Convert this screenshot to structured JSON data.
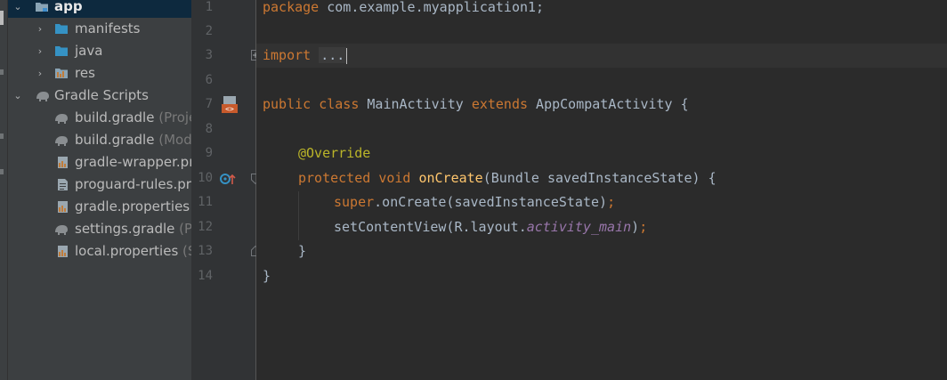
{
  "project_tree": {
    "items": [
      {
        "label": "app",
        "suffix": "",
        "icon": "module-folder-icon",
        "arrow": "expanded"
      },
      {
        "label": "manifests",
        "suffix": "",
        "icon": "folder-icon",
        "arrow": "collapsed"
      },
      {
        "label": "java",
        "suffix": "",
        "icon": "folder-icon",
        "arrow": "collapsed"
      },
      {
        "label": "res",
        "suffix": "",
        "icon": "resource-folder-icon",
        "arrow": "collapsed"
      },
      {
        "label": "Gradle Scripts",
        "suffix": "",
        "icon": "gradle-elephant-icon",
        "arrow": "expanded"
      },
      {
        "label": "build.gradle",
        "suffix": " (Proje",
        "icon": "gradle-elephant-icon"
      },
      {
        "label": "build.gradle",
        "suffix": " (Mod",
        "icon": "gradle-elephant-icon"
      },
      {
        "label": "gradle-wrapper.pı",
        "suffix": "",
        "icon": "properties-file-icon"
      },
      {
        "label": "proguard-rules.pr",
        "suffix": "",
        "icon": "text-file-icon"
      },
      {
        "label": "gradle.properties",
        "suffix": "",
        "icon": "properties-file-icon"
      },
      {
        "label": "settings.gradle",
        "suffix": " (Pı",
        "icon": "gradle-elephant-icon"
      },
      {
        "label": "local.properties",
        "suffix": " (S",
        "icon": "properties-file-icon"
      }
    ]
  },
  "editor": {
    "line_numbers": [
      "1",
      "2",
      "3",
      "6",
      "7",
      "8",
      "9",
      "10",
      "11",
      "12",
      "13",
      "14"
    ],
    "lines": {
      "l1_kw": "package",
      "l1_rest": " com.example.myapplication1;",
      "l3_kw": "import",
      "l3_fold": "...",
      "l7_kw1": "public",
      "l7_kw2": "class",
      "l7_name": " MainActivity ",
      "l7_kw3": "extends",
      "l7_rest": " AppCompatActivity {",
      "l9_ann": "@Override",
      "l10_kw1": "protected",
      "l10_kw2": "void",
      "l10_fn": "onCreate",
      "l10_rest": "(Bundle savedInstanceState) {",
      "l11_kw": "super",
      "l11_rest": ".onCreate(savedInstanceState)",
      "l11_semi": ";",
      "l12_a": "setContentView(R.layout.",
      "l12_fld": "activity_main",
      "l12_b": ")",
      "l12_semi": ";",
      "l13": "}",
      "l14": "}"
    }
  },
  "colors": {
    "keyword": "#cc7832",
    "annotation": "#bbb529",
    "method": "#ffc66d",
    "field": "#9876aa",
    "text": "#a9b7c6",
    "background": "#2b2b2b",
    "panel": "#3c3f41"
  }
}
